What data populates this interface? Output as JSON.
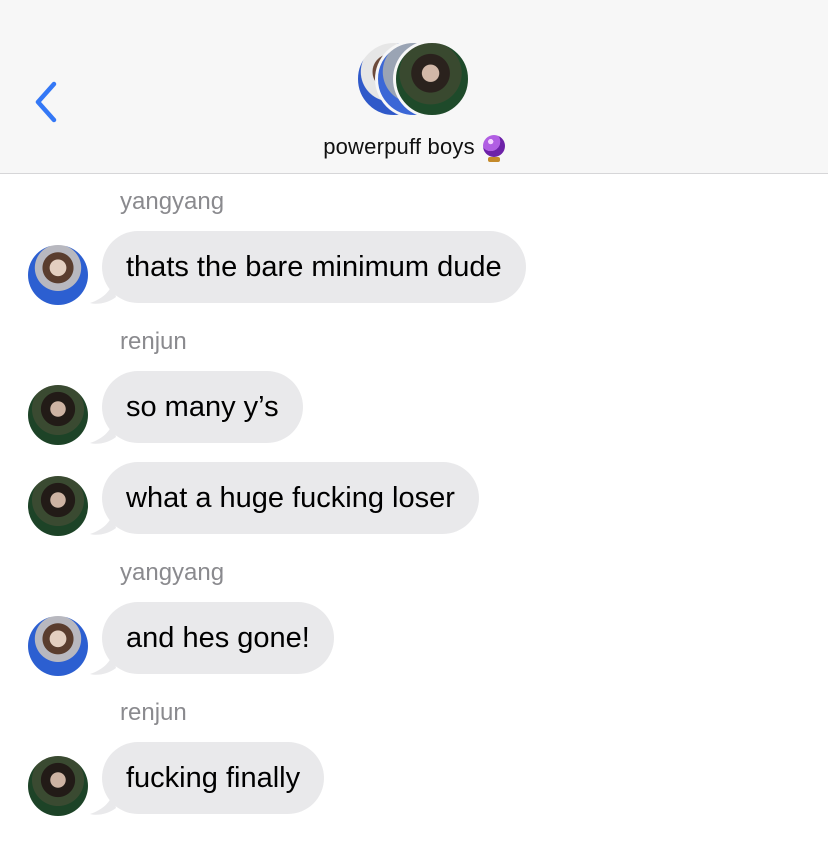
{
  "conversation": {
    "title": "powerpuff boys",
    "title_emoji": "crystal-ball",
    "back_icon": "chevron-left-icon"
  },
  "colors": {
    "accent": "#3478f6",
    "bubble": "#e9e9eb",
    "header_bg": "#f7f7f7",
    "sender_text": "#8a8a8e"
  },
  "messages": [
    {
      "sender": "yangyang",
      "text": "thats the bare minimum dude"
    },
    {
      "sender": "renjun",
      "text": "so many y's"
    },
    {
      "sender": "renjun",
      "text": "what a huge fucking loser"
    },
    {
      "sender": "yangyang",
      "text": "and hes gone!"
    },
    {
      "sender": "renjun",
      "text": "fucking finally"
    }
  ],
  "sender_labels": {
    "s1": "yangyang",
    "s2": "renjun",
    "s3": "yangyang",
    "s4": "renjun"
  },
  "bubbles": {
    "m1": "thats the bare minimum dude",
    "m2": "so many y’s",
    "m3": "what a huge fucking loser",
    "m4": "and hes gone!",
    "m5": "fucking finally"
  }
}
